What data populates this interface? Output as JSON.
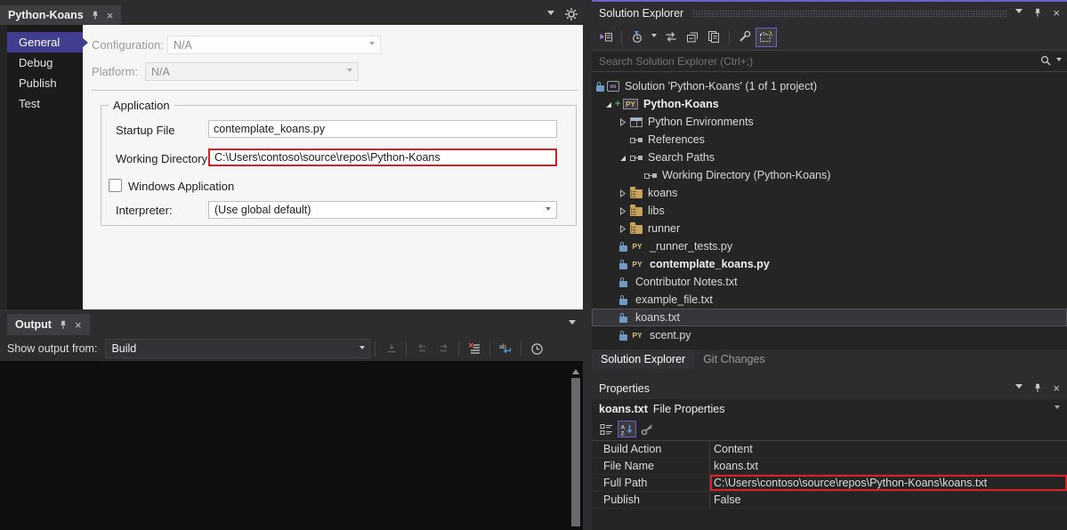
{
  "colors": {
    "accent_purple": "#6a60c8",
    "nav_selected_purple": "#413e90",
    "highlight_red": "#df1d24",
    "lock_blue": "#6d9bc3",
    "folder_tan": "#c9a25e",
    "python_gold": "#d7ba7d",
    "plus_green": "#4cae4f",
    "wrap_blue": "#569cd6"
  },
  "editor": {
    "tab_title": "Python-Koans",
    "nav": {
      "selected": "General",
      "items": [
        "General",
        "Debug",
        "Publish",
        "Test"
      ]
    },
    "form": {
      "configuration_label": "Configuration:",
      "configuration_value": "N/A",
      "platform_label": "Platform:",
      "platform_value": "N/A",
      "group_title": "Application",
      "startup_file_label": "Startup File",
      "startup_file_value": "contemplate_koans.py",
      "working_directory_label": "Working Directory",
      "working_directory_value": "C:\\Users\\contoso\\source\\repos\\Python-Koans",
      "windows_application_label": "Windows Application",
      "windows_application_checked": false,
      "interpreter_label": "Interpreter:",
      "interpreter_value": "(Use global default)"
    }
  },
  "output": {
    "tab_title": "Output",
    "show_output_from_label": "Show output from:",
    "source_value": "Build"
  },
  "solution_explorer": {
    "title": "Solution Explorer",
    "search_placeholder": "Search Solution Explorer (Ctrl+;)",
    "tree": [
      {
        "label": "Solution 'Python-Koans' (1 of 1 project)",
        "icon": "solution",
        "level": 0,
        "exp": "none",
        "lock": true
      },
      {
        "label": "Python-Koans",
        "icon": "python-project",
        "level": 1,
        "exp": "open",
        "plus": true,
        "bold": true
      },
      {
        "label": "Python Environments",
        "icon": "environments",
        "level": 2,
        "exp": "closed"
      },
      {
        "label": "References",
        "icon": "references",
        "level": 2,
        "exp": "none"
      },
      {
        "label": "Search Paths",
        "icon": "references",
        "level": 2,
        "exp": "open"
      },
      {
        "label": "Working Directory (Python-Koans)",
        "icon": "references",
        "level": 3,
        "exp": "none"
      },
      {
        "label": "koans",
        "icon": "folder",
        "level": 2,
        "exp": "closed"
      },
      {
        "label": "libs",
        "icon": "folder",
        "level": 2,
        "exp": "closed"
      },
      {
        "label": "runner",
        "icon": "folder",
        "level": 2,
        "exp": "closed"
      },
      {
        "label": "_runner_tests.py",
        "icon": "python-file",
        "level": 2,
        "exp": "none",
        "lock": true
      },
      {
        "label": "contemplate_koans.py",
        "icon": "python-file",
        "level": 2,
        "exp": "none",
        "lock": true,
        "bold": true
      },
      {
        "label": "Contributor Notes.txt",
        "icon": "text-file",
        "level": 2,
        "exp": "none",
        "lock": true
      },
      {
        "label": "example_file.txt",
        "icon": "text-file",
        "level": 2,
        "exp": "none",
        "lock": true
      },
      {
        "label": "koans.txt",
        "icon": "text-file",
        "level": 2,
        "exp": "none",
        "lock": true,
        "selected": true
      },
      {
        "label": "scent.py",
        "icon": "python-file",
        "level": 2,
        "exp": "none",
        "lock": true
      }
    ],
    "bottom_tabs": [
      {
        "label": "Solution Explorer",
        "active": true
      },
      {
        "label": "Git Changes",
        "active": false
      }
    ]
  },
  "properties": {
    "title": "Properties",
    "object_name": "koans.txt",
    "object_kind": "File Properties",
    "rows": [
      {
        "name": "Build Action",
        "value": "Content",
        "highlight": false
      },
      {
        "name": "File Name",
        "value": "koans.txt",
        "highlight": false
      },
      {
        "name": "Full Path",
        "value": "C:\\Users\\contoso\\source\\repos\\Python-Koans\\koans.txt",
        "highlight": true
      },
      {
        "name": "Publish",
        "value": "False",
        "highlight": false
      }
    ]
  },
  "icons": {
    "pin-icon": "pushpin",
    "close-icon": "×",
    "dropdown-caret-icon": "▾",
    "gear-icon": "gear",
    "switch-views-icon": "ide-switch-view",
    "pending-changes-filter-icon": "clock-filter",
    "sync-active-document-icon": "⇄",
    "collapse-all-icon": "collapse-all",
    "preview-selected-icon": "stacked-windows",
    "properties-wrench-icon": "wrench",
    "show-all-files-icon": "dashed-folder",
    "search-icon": "magnifier",
    "goto-message-icon": "goto-arrow",
    "previous-message-icon": "←",
    "next-message-icon": "→",
    "clear-all-icon": "list-with-red-x",
    "word-wrap-icon": "ab-return",
    "timestamp-clock-icon": "clock",
    "categorized-icon": "category-grid",
    "alphabetical-icon": "A-Z-down-arrow",
    "property-pages-icon": "key",
    "lock-icon": "blue-padlock",
    "expander-collapsed-icon": "hollow-right-triangle",
    "expander-expanded-icon": "filled-lower-right-triangle"
  }
}
